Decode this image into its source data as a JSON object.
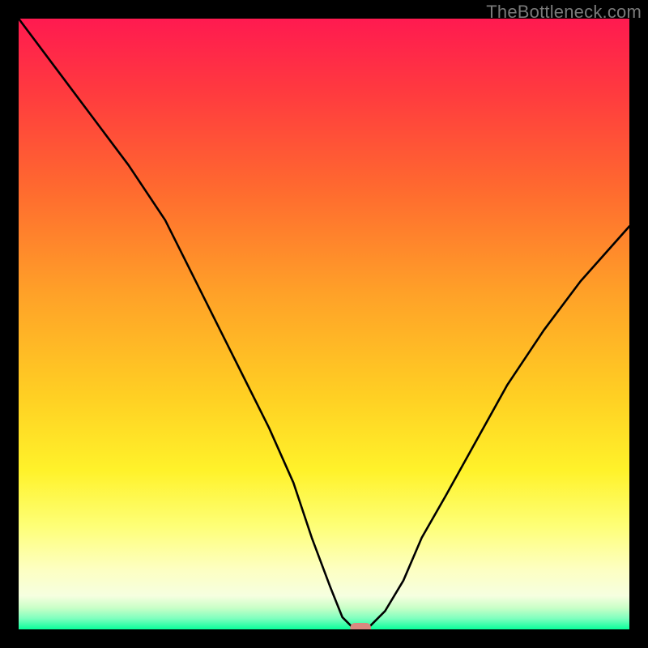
{
  "watermark": "TheBottleneck.com",
  "chart_data": {
    "type": "line",
    "title": "",
    "xlabel": "",
    "ylabel": "",
    "xlim": [
      0,
      100
    ],
    "ylim": [
      0,
      100
    ],
    "grid": false,
    "legend": false,
    "background": {
      "type": "vertical_gradient",
      "stops": [
        {
          "pos": 0.0,
          "color": "#ff1a50"
        },
        {
          "pos": 0.12,
          "color": "#ff3a3f"
        },
        {
          "pos": 0.28,
          "color": "#ff6a2f"
        },
        {
          "pos": 0.45,
          "color": "#ffa128"
        },
        {
          "pos": 0.62,
          "color": "#ffd023"
        },
        {
          "pos": 0.74,
          "color": "#fff22a"
        },
        {
          "pos": 0.83,
          "color": "#feff76"
        },
        {
          "pos": 0.9,
          "color": "#fdffc0"
        },
        {
          "pos": 0.945,
          "color": "#f6ffe0"
        },
        {
          "pos": 0.965,
          "color": "#c8ffc7"
        },
        {
          "pos": 0.982,
          "color": "#7fffbf"
        },
        {
          "pos": 1.0,
          "color": "#0aff9b"
        }
      ]
    },
    "series": [
      {
        "name": "bottleneck-curve",
        "color": "#000000",
        "width": 2.6,
        "x": [
          0,
          6,
          12,
          18,
          24,
          29,
          33,
          37,
          41,
          45,
          48,
          51,
          53,
          55,
          57,
          60,
          63,
          66,
          70,
          75,
          80,
          86,
          92,
          100
        ],
        "y": [
          100,
          92,
          84,
          76,
          67,
          57,
          49,
          41,
          33,
          24,
          15,
          7,
          2,
          0,
          0,
          3,
          8,
          15,
          22,
          31,
          40,
          49,
          57,
          66
        ]
      }
    ],
    "marker": {
      "name": "optimum-marker",
      "shape": "rounded-rect",
      "color": "#d9887f",
      "x": 56,
      "y": 0,
      "width_pct": 3.4,
      "height_pct": 1.6
    }
  }
}
